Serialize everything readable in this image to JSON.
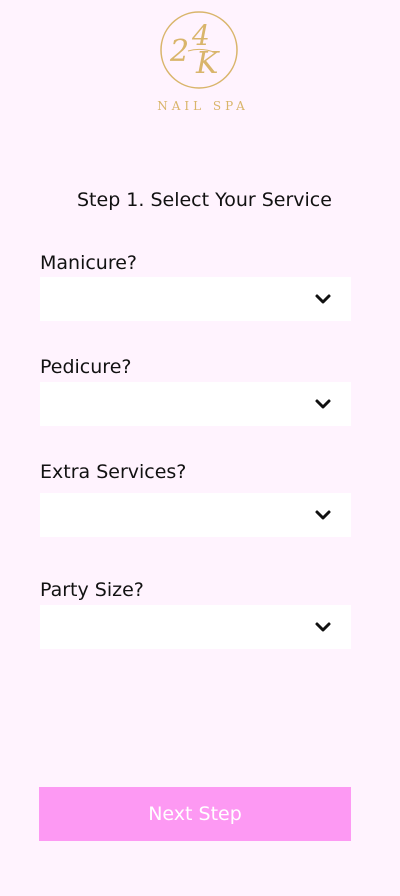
{
  "logo": {
    "monogram": "24K",
    "subtitle": "NAIL SPA"
  },
  "step_title": "Step 1. Select Your Service",
  "fields": [
    {
      "label": "Manicure?",
      "value": ""
    },
    {
      "label": "Pedicure?",
      "value": ""
    },
    {
      "label": "Extra Services?",
      "value": ""
    },
    {
      "label": "Party Size?",
      "value": ""
    }
  ],
  "next_button": {
    "label": "Next Step"
  },
  "colors": {
    "background": "#fff3fe",
    "gold": "#d9b56b",
    "button": "#fd99f3",
    "select_bg": "#ffffff"
  },
  "icons": {
    "dropdown": "chevron-down-icon"
  }
}
